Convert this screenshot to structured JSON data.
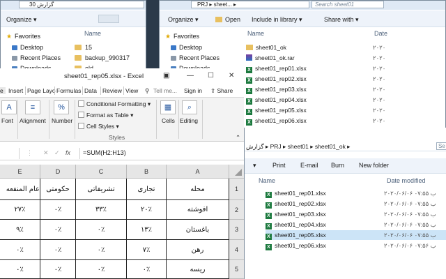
{
  "explorer_back_left": {
    "address": "گزارش 30",
    "toolbar": {
      "organize": "Organize ▾"
    },
    "nav": [
      "Favorites",
      "Desktop",
      "Recent Places",
      "Downloads"
    ],
    "list_header": "Name",
    "items": [
      "15",
      "backup_990317",
      "old"
    ]
  },
  "explorer_back_right": {
    "address": "PRJ ▸ sheet... ▸",
    "search_placeholder": "Search sheet01",
    "toolbar": {
      "organize": "Organize ▾",
      "open": "Open",
      "include": "Include in library ▾",
      "share": "Share with ▾"
    },
    "nav": [
      "Favorites",
      "Desktop",
      "Recent Places",
      "Downloads"
    ],
    "col_name": "Name",
    "col_date": "Date",
    "files": [
      {
        "name": "sheet01_ok",
        "date": "۲۰۲۰",
        "type": "folder"
      },
      {
        "name": "sheet01_ok.rar",
        "date": "۲۰۲۰",
        "type": "rar"
      },
      {
        "name": "sheet01_rep01.xlsx",
        "date": "۲۰۲۰",
        "type": "xlsx"
      },
      {
        "name": "sheet01_rep02.xlsx",
        "date": "۲۰۲۰",
        "type": "xlsx"
      },
      {
        "name": "sheet01_rep03.xlsx",
        "date": "۲۰۲۰",
        "type": "xlsx"
      },
      {
        "name": "sheet01_rep04.xlsx",
        "date": "۲۰۲۰",
        "type": "xlsx"
      },
      {
        "name": "sheet01_rep05.xlsx",
        "date": "۲۰۲۰",
        "type": "xlsx"
      },
      {
        "name": "sheet01_rep06.xlsx",
        "date": "۲۰۲۰",
        "type": "xlsx"
      }
    ]
  },
  "explorer_front": {
    "address": "گزارش ▸ PRJ ▸ sheet01 ▸ sheet01_ok ▸",
    "search_placeholder": "Se",
    "toolbar": {
      "print": "Print",
      "email": "E-mail",
      "burn": "Burn",
      "new_folder": "New folder"
    },
    "col_name": "Name",
    "col_date": "Date modified",
    "files": [
      {
        "name": "sheet01_rep01.xlsx",
        "date": "۲۰۲۰/۰۶/۰۶ ۰۷:۵۵ ب"
      },
      {
        "name": "sheet01_rep02.xlsx",
        "date": "۲۰۲۰/۰۶/۰۶ ۰۷:۵۵ ب"
      },
      {
        "name": "sheet01_rep03.xlsx",
        "date": "۲۰۲۰/۰۶/۰۶ ۰۷:۵۵ ب"
      },
      {
        "name": "sheet01_rep04.xlsx",
        "date": "۲۰۲۰/۰۶/۰۶ ۰۷:۵۵ ب"
      },
      {
        "name": "sheet01_rep05.xlsx",
        "date": "۲۰۲۰/۰۶/۰۶ ۰۷:۵۵ ب"
      },
      {
        "name": "sheet01_rep06.xlsx",
        "date": "۲۰۲۰/۰۶/۰۶ ۰۷:۵۶ ب"
      }
    ],
    "selected_index": 4
  },
  "excel": {
    "title": "sheet01_rep05.xlsx - Excel",
    "tabs": [
      "e",
      "Insert",
      "Page Layo",
      "Formulas",
      "Data",
      "Review",
      "View",
      "Tell me...",
      "Sign in",
      "Share"
    ],
    "ribbon": {
      "font": "Font",
      "alignment": "Alignment",
      "number": "Number",
      "conditional": "Conditional Formatting ▾",
      "format_table": "Format as Table ▾",
      "cell_styles": "Cell Styles ▾",
      "styles_group": "Styles",
      "cells": "Cells",
      "editing": "Editing"
    },
    "formula": "=SUM(H2:H13)",
    "fx": "fx",
    "columns": [
      "E",
      "D",
      "C",
      "B",
      "A"
    ],
    "rows": [
      [
        "عام المنفعه",
        "حکومتی",
        "تشریفاتی",
        "تجاری",
        "محله"
      ],
      [
        "۲۷٪",
        "۰٪",
        "۳۳٪",
        "۲۰٪",
        "افوشته"
      ],
      [
        "۹٪",
        "۰٪",
        "۰٪",
        "۱۳٪",
        "باغستان"
      ],
      [
        "۰٪",
        "۰٪",
        "۰٪",
        "۷٪",
        "رهن"
      ],
      [
        "۰٪",
        "۰٪",
        "۰٪",
        "۰٪",
        "ریسه"
      ]
    ],
    "row_numbers": [
      "1",
      "2",
      "3",
      "4",
      "5"
    ]
  }
}
